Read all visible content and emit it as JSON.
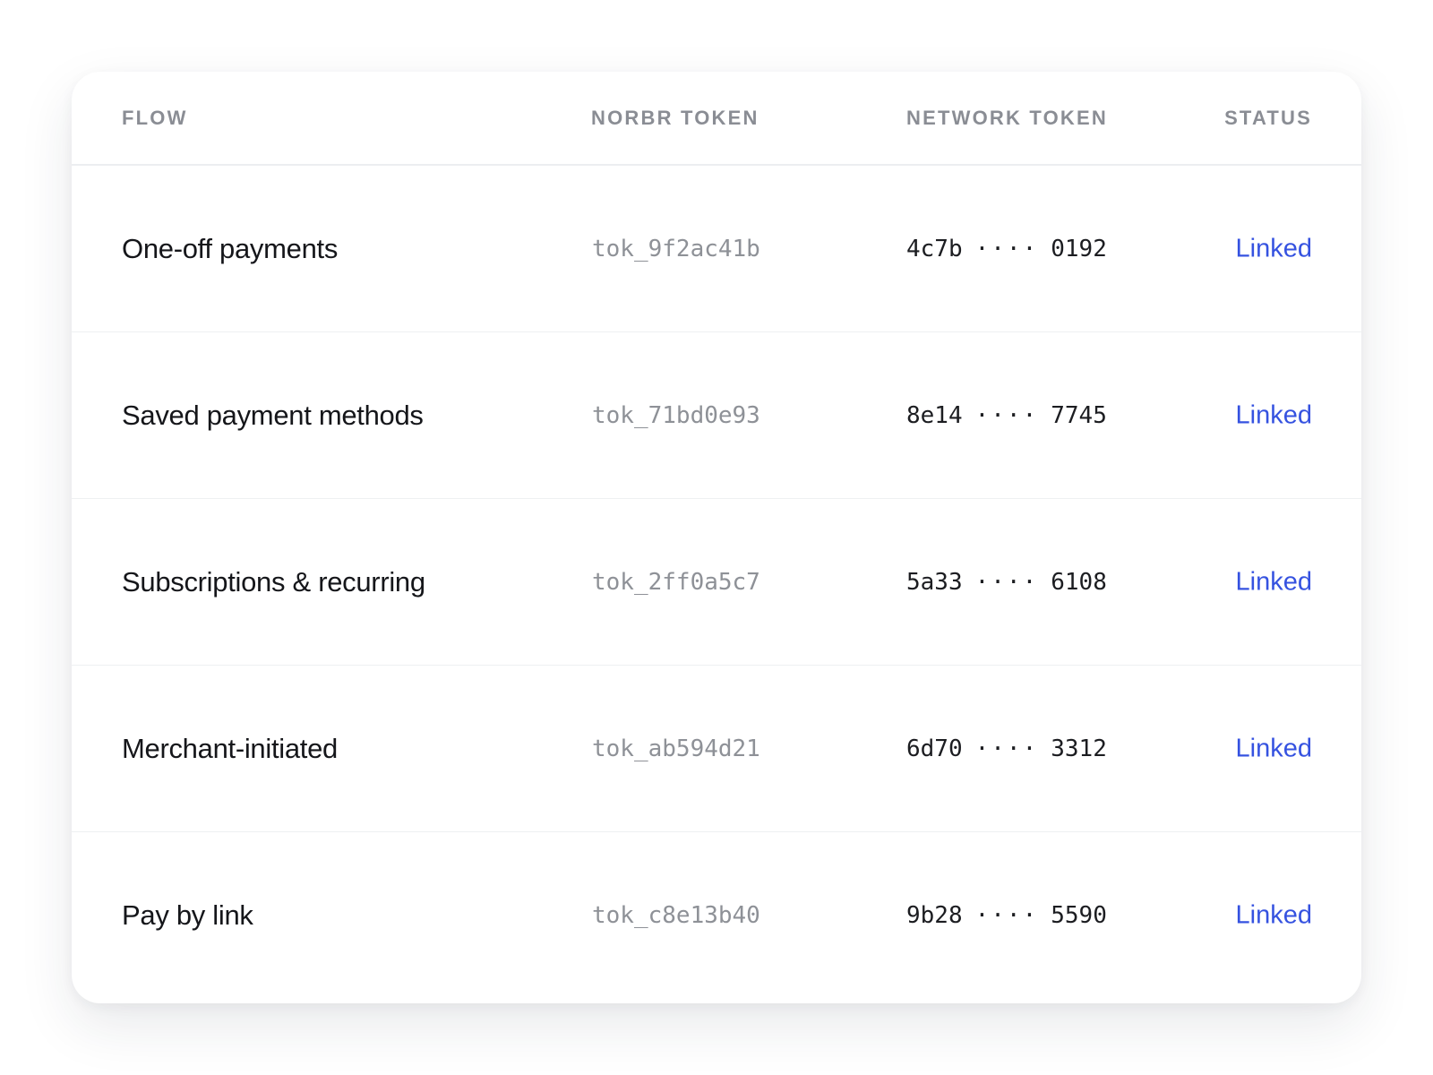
{
  "table": {
    "headers": {
      "flow": "FLOW",
      "norbr_token": "NORBR TOKEN",
      "network_token": "NETWORK TOKEN",
      "status": "STATUS"
    },
    "rows": [
      {
        "flow": "One-off payments",
        "norbr_token": "tok_9f2ac41b",
        "network_token_prefix": "4c7b",
        "network_token_mask": "····",
        "network_token_suffix": "0192",
        "status": "Linked"
      },
      {
        "flow": "Saved payment methods",
        "norbr_token": "tok_71bd0e93",
        "network_token_prefix": "8e14",
        "network_token_mask": "····",
        "network_token_suffix": "7745",
        "status": "Linked"
      },
      {
        "flow": "Subscriptions & recurring",
        "norbr_token": "tok_2ff0a5c7",
        "network_token_prefix": "5a33",
        "network_token_mask": "····",
        "network_token_suffix": "6108",
        "status": "Linked"
      },
      {
        "flow": "Merchant-initiated",
        "norbr_token": "tok_ab594d21",
        "network_token_prefix": "6d70",
        "network_token_mask": "····",
        "network_token_suffix": "3312",
        "status": "Linked"
      },
      {
        "flow": "Pay by link",
        "norbr_token": "tok_c8e13b40",
        "network_token_prefix": "9b28",
        "network_token_mask": "····",
        "network_token_suffix": "5590",
        "status": "Linked"
      }
    ]
  },
  "colors": {
    "status_linked": "#3552e0",
    "header_text": "#8a8d94",
    "muted_token": "#8e9197"
  }
}
